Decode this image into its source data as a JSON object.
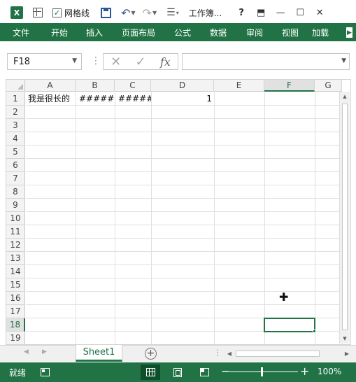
{
  "titlebar": {
    "app_icon": "excel-icon",
    "gridlines_checkbox": {
      "label": "网格线",
      "checked": true
    },
    "title": "工作簿..."
  },
  "ribbon": {
    "tabs": [
      {
        "label": "文件",
        "active": true
      },
      {
        "label": "开始"
      },
      {
        "label": "插入"
      },
      {
        "label": "页面布局"
      },
      {
        "label": "公式"
      },
      {
        "label": "数据"
      },
      {
        "label": "审阅"
      },
      {
        "label": "视图"
      },
      {
        "label": "加载"
      }
    ]
  },
  "formula_bar": {
    "name_box": "F18",
    "fx_label": "fx",
    "formula_value": ""
  },
  "grid": {
    "columns": [
      "A",
      "B",
      "C",
      "D",
      "E",
      "F",
      "G"
    ],
    "rows": [
      "1",
      "2",
      "3",
      "4",
      "5",
      "6",
      "7",
      "8",
      "9",
      "10",
      "11",
      "12",
      "13",
      "14",
      "15",
      "16",
      "17",
      "18",
      "19"
    ],
    "selected_column": "F",
    "selected_row": "18",
    "cells": {
      "A1": "我是很长的",
      "B1": "#####",
      "C1": "#####",
      "D1": "1"
    }
  },
  "sheets": {
    "tabs": [
      "Sheet1"
    ],
    "active": "Sheet1"
  },
  "statusbar": {
    "status": "就绪",
    "zoom": "100%",
    "zoom_percent": 100
  },
  "colors": {
    "accent": "#217346",
    "grid_line": "#e0e0e0",
    "header_bg": "#f3f3f3"
  }
}
